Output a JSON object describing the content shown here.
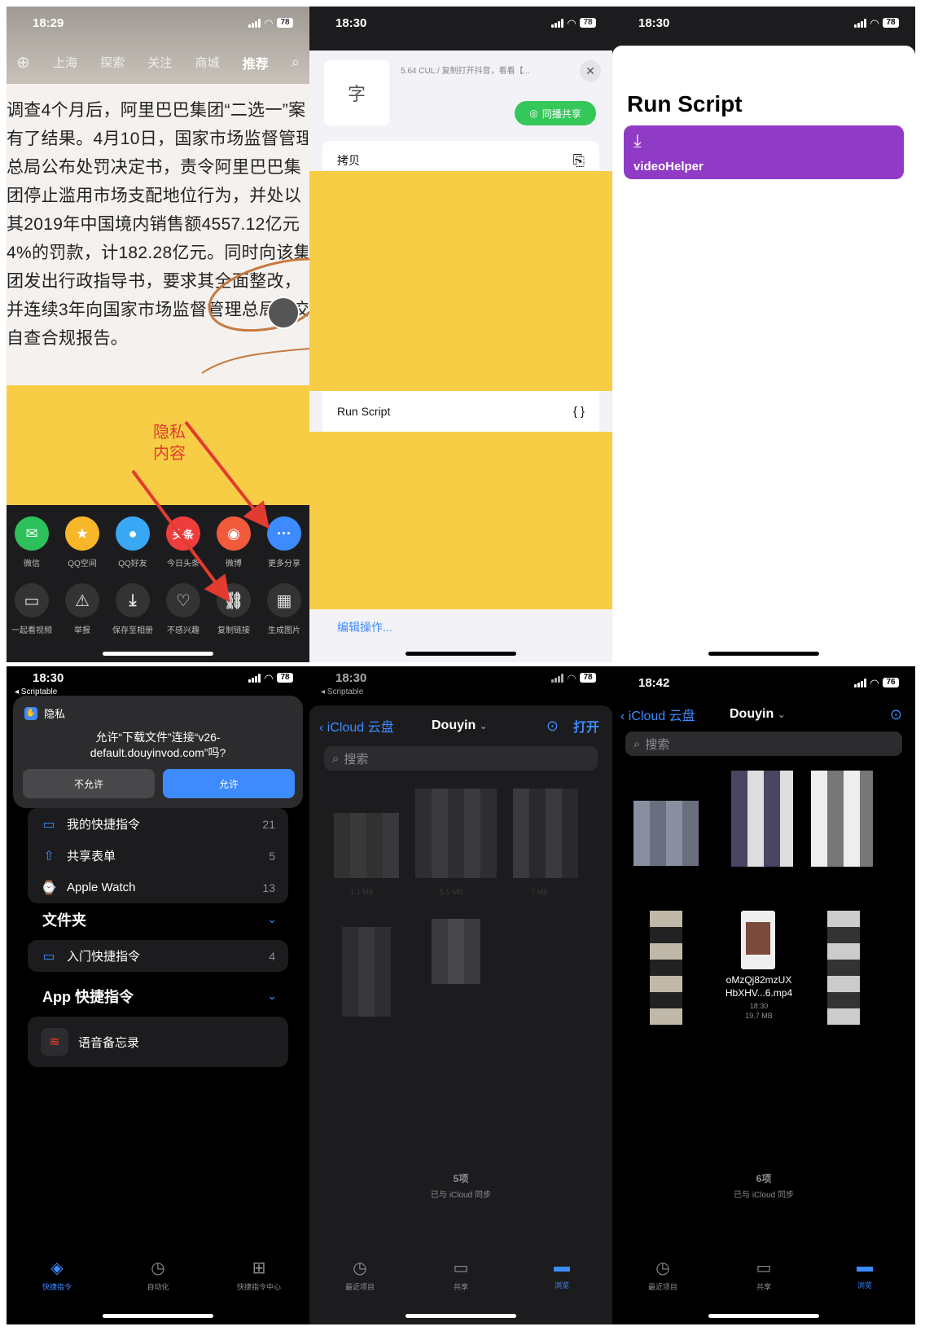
{
  "panel1": {
    "time": "18:29",
    "battery": "78",
    "nav_tabs": [
      "上海",
      "探索",
      "关注",
      "商城",
      "推荐"
    ],
    "article_lines": [
      "调查4个月后，阿里巴巴集团“二选一”案",
      "有了结果。4月10日，国家市场监督管理",
      "总局公布处罚决定书，责令阿里巴巴集",
      "团停止滥用市场支配地位行为，并处以",
      "其2019年中国境内销售额4557.12亿元",
      "4%的罚款，计182.28亿元。同时向该集",
      "团发出行政指导书，要求其全面整改，",
      "并连续3年向国家市场监督管理总局提交",
      "自查合规报告。"
    ],
    "privacy_note_line1": "隐私",
    "privacy_note_line2": "内容",
    "share_row1": [
      {
        "label": "微信",
        "icon": "wechat-icon",
        "color": "#2dc15b",
        "glyph": "✉"
      },
      {
        "label": "QQ空间",
        "icon": "qzone-star-icon",
        "color": "#f7b728",
        "glyph": "★"
      },
      {
        "label": "QQ好友",
        "icon": "qq-icon",
        "color": "#38a8f5",
        "glyph": "●"
      },
      {
        "label": "今日头条",
        "icon": "toutiao-icon",
        "color": "#ef3d3d",
        "glyph": "头条"
      },
      {
        "label": "微博",
        "icon": "weibo-icon",
        "color": "#f25a3c",
        "glyph": "◉"
      },
      {
        "label": "更多分享",
        "icon": "more-icon",
        "color": "#3d8bff",
        "glyph": "···"
      }
    ],
    "share_row2": [
      {
        "label": "一起看视频",
        "icon": "sofa-icon",
        "glyph": "▭"
      },
      {
        "label": "举报",
        "icon": "warning-icon",
        "glyph": "⚠"
      },
      {
        "label": "保存至相册",
        "icon": "download-icon",
        "glyph": "⤓"
      },
      {
        "label": "不感兴趣",
        "icon": "broken-heart-icon",
        "glyph": "♡"
      },
      {
        "label": "复制链接",
        "icon": "link-icon",
        "glyph": "⛓"
      },
      {
        "label": "生成图片",
        "icon": "grid-icon",
        "glyph": "▦"
      }
    ]
  },
  "panel2": {
    "time": "18:30",
    "battery": "78",
    "preview_text": "5.64 CUL:/ 复制打开抖音，看看【...",
    "preview_glyph": "字",
    "share_button": "同播共享",
    "copy_label": "拷贝",
    "run_script_label": "Run Script",
    "run_script_glyph": "{ }",
    "edit_actions": "编辑操作..."
  },
  "panel3": {
    "time": "18:30",
    "battery": "78",
    "title": "Run Script",
    "script_name": "videoHelper",
    "script_color": "#8f3bc6"
  },
  "panel4": {
    "time": "18:30",
    "back_app": "◂ Scriptable",
    "battery": "78",
    "privacy_header": "隐私",
    "prompt_line1": "允许“下载文件”连接“v26-",
    "prompt_line2": "default.douyinvod.com”吗?",
    "deny": "不允许",
    "allow": "允许",
    "list": [
      {
        "label": "我的快捷指令",
        "count": "21"
      },
      {
        "label": "共享表单",
        "count": "5"
      },
      {
        "label": "Apple Watch",
        "count": "13"
      }
    ],
    "folders_title": "文件夹",
    "folder_item": {
      "label": "入门快捷指令",
      "count": "4"
    },
    "app_shortcuts_title": "App 快捷指令",
    "app_item": "语音备忘录",
    "tabs": [
      "快捷指令",
      "自动化",
      "快捷指令中心"
    ]
  },
  "panel5": {
    "time": "18:30",
    "back_app": "◂ Scriptable",
    "battery": "78",
    "back_label": "iCloud 云盘",
    "folder": "Douyin",
    "open_label": "打开",
    "search_placeholder": "搜索",
    "sizes": [
      "1.1 MB",
      "5.5 MB",
      "7 MB"
    ],
    "items_count": "5项",
    "sync_status": "已与 iCloud 同步",
    "tabs": [
      "最近项目",
      "共享",
      "浏览"
    ]
  },
  "panel6": {
    "time": "18:42",
    "battery": "76",
    "back_label": "iCloud 云盘",
    "folder": "Douyin",
    "search_placeholder": "搜索",
    "file_name_line1": "oMzQj82mzUX",
    "file_name_line2": "HbXHV...6.mp4",
    "file_time": "18:30",
    "file_size": "19.7 MB",
    "items_count": "6项",
    "sync_status": "已与 iCloud 同步",
    "tabs": [
      "最近项目",
      "共享",
      "浏览"
    ]
  }
}
